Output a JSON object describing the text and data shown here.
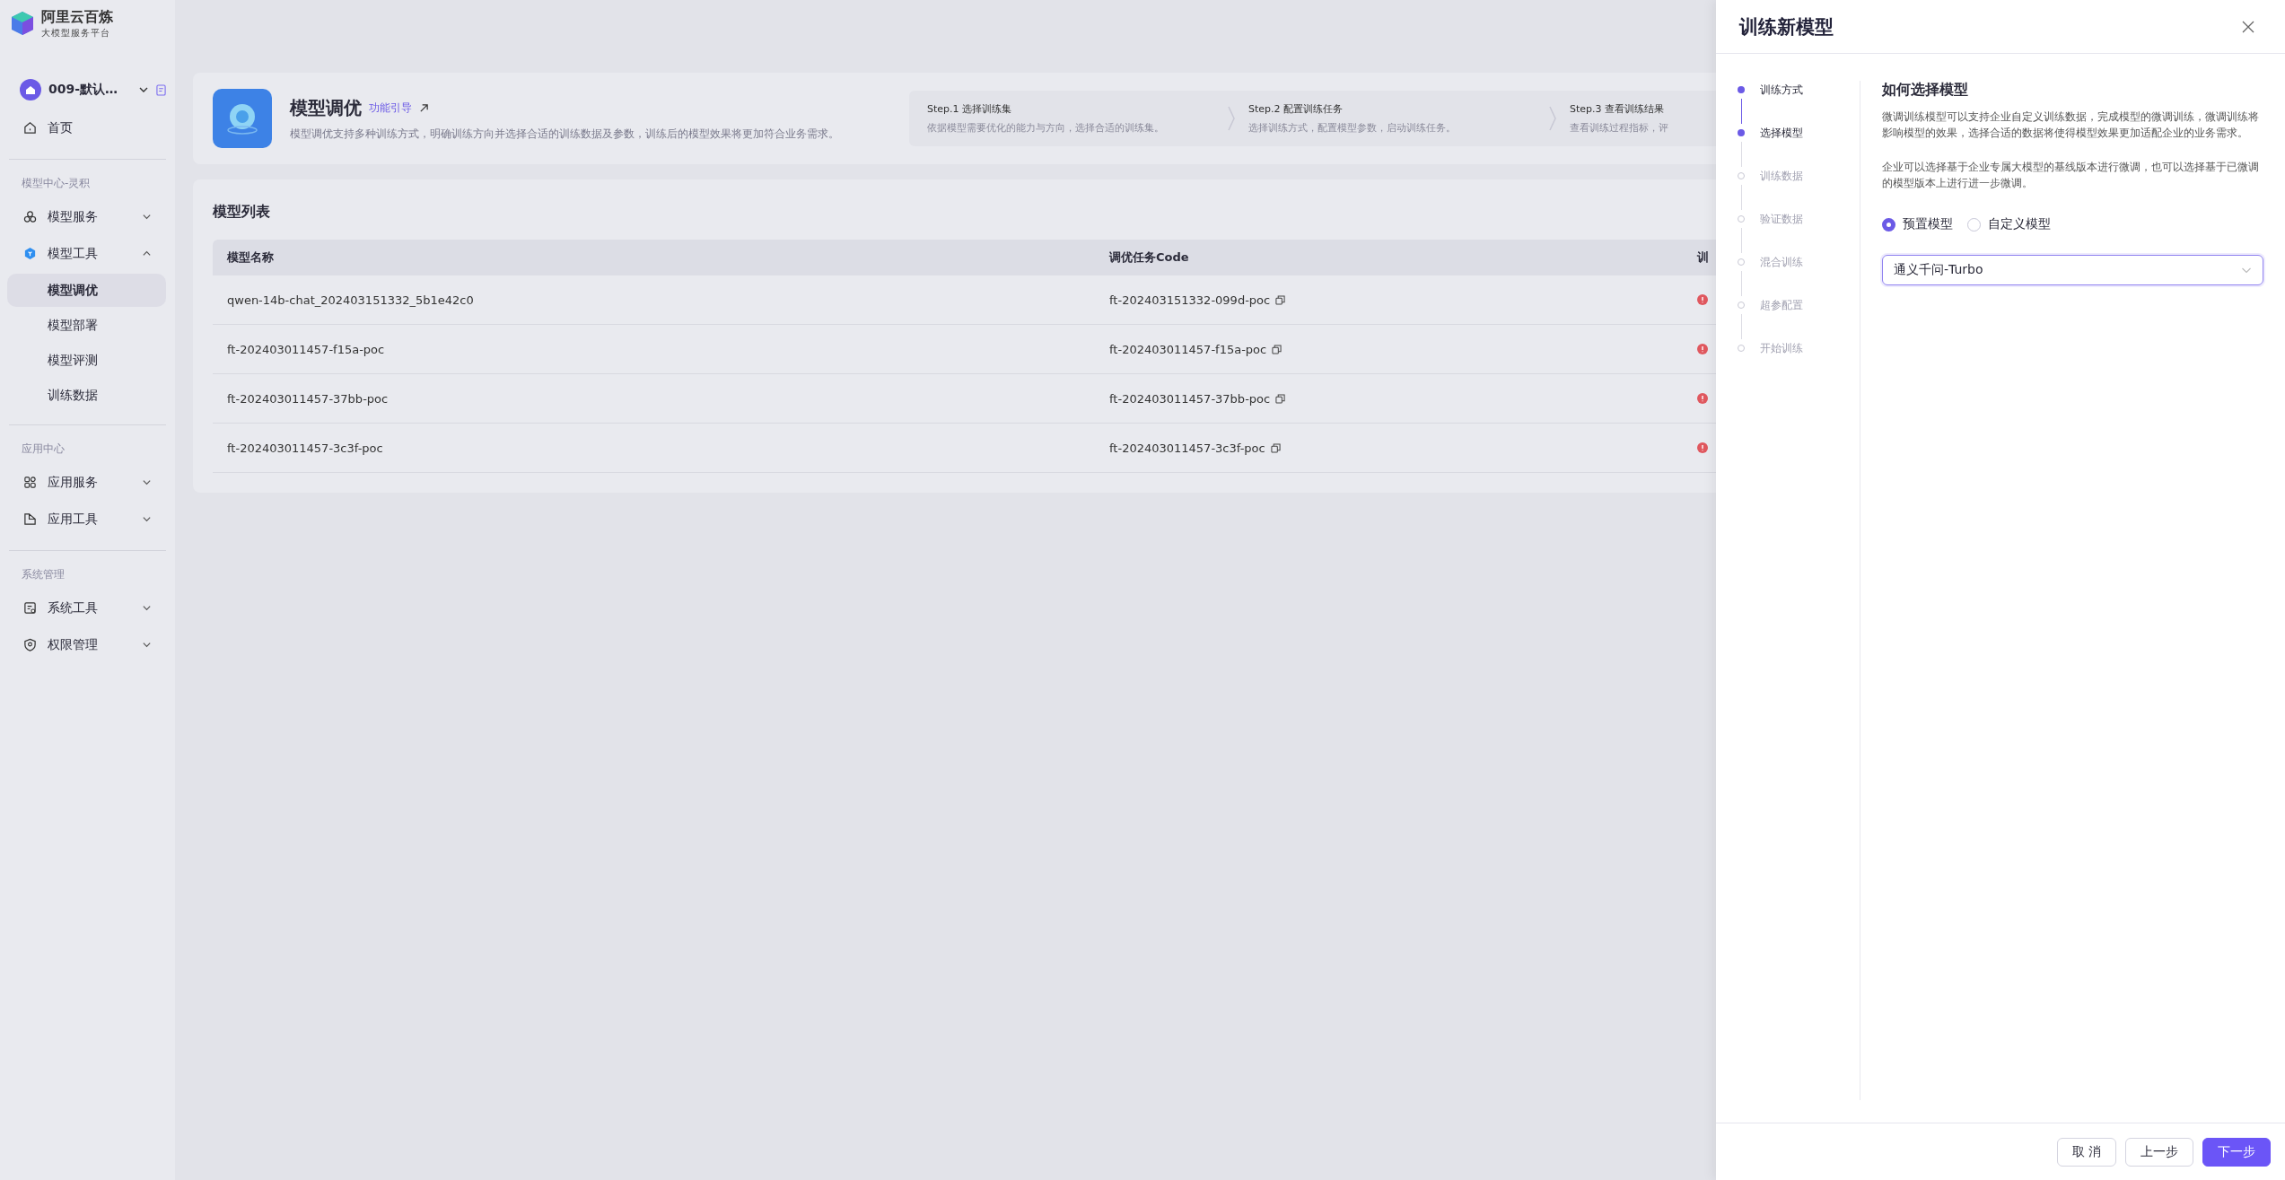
{
  "brand": {
    "title": "阿里云百炼",
    "subtitle": "大模型服务平台"
  },
  "sidebar": {
    "workspace": "009-默认…",
    "home": "首页",
    "sections": [
      {
        "title": "模型中心-灵积",
        "items": [
          {
            "label": "模型服务",
            "expanded": false
          },
          {
            "label": "模型工具",
            "expanded": true,
            "children": [
              {
                "label": "模型调优",
                "selected": true
              },
              {
                "label": "模型部署",
                "selected": false
              },
              {
                "label": "模型评测",
                "selected": false
              },
              {
                "label": "训练数据",
                "selected": false
              }
            ]
          }
        ]
      },
      {
        "title": "应用中心",
        "items": [
          {
            "label": "应用服务",
            "expanded": false
          },
          {
            "label": "应用工具",
            "expanded": false
          }
        ]
      },
      {
        "title": "系统管理",
        "items": [
          {
            "label": "系统工具",
            "expanded": false
          },
          {
            "label": "权限管理",
            "expanded": false
          }
        ]
      }
    ]
  },
  "intro": {
    "title": "模型调优",
    "guide_link": "功能引导",
    "description": "模型调优支持多种训练方式，明确训练方向并选择合适的训练数据及参数，训练后的模型效果将更加符合业务需求。",
    "steps": [
      {
        "title": "Step.1 选择训练集",
        "description": "依据模型需要优化的能力与方向，选择合适的训练集。"
      },
      {
        "title": "Step.2 配置训练任务",
        "description": "选择训练方式，配置模型参数，启动训练任务。"
      },
      {
        "title": "Step.3 查看训练结果",
        "description": "查看训练过程指标，评"
      }
    ]
  },
  "table": {
    "title": "模型列表",
    "columns": [
      "模型名称",
      "调优任务Code",
      "训"
    ],
    "rows": [
      {
        "name": "qwen-14b-chat_202403151332_5b1e42c0",
        "code": "ft-202403151332-099d-poc"
      },
      {
        "name": "ft-202403011457-f15a-poc",
        "code": "ft-202403011457-f15a-poc"
      },
      {
        "name": "ft-202403011457-37bb-poc",
        "code": "ft-202403011457-37bb-poc"
      },
      {
        "name": "ft-202403011457-3c3f-poc",
        "code": "ft-202403011457-3c3f-poc"
      }
    ]
  },
  "drawer": {
    "title": "训练新模型",
    "steps": [
      {
        "label": "训练方式",
        "done": true
      },
      {
        "label": "选择模型",
        "done": true
      },
      {
        "label": "训练数据",
        "done": false
      },
      {
        "label": "验证数据",
        "done": false
      },
      {
        "label": "混合训练",
        "done": false
      },
      {
        "label": "超参配置",
        "done": false
      },
      {
        "label": "开始训练",
        "done": false
      }
    ],
    "heading": "如何选择模型",
    "paragraphs": [
      "微调训练模型可以支持企业自定义训练数据，完成模型的微调训练，微调训练将影响模型的效果，选择合适的数据将使得模型效果更加适配企业的业务需求。",
      "企业可以选择基于企业专属大模型的基线版本进行微调，也可以选择基于已微调的模型版本上进行进一步微调。"
    ],
    "model_source": [
      {
        "label": "预置模型",
        "selected": true
      },
      {
        "label": "自定义模型",
        "selected": false
      }
    ],
    "model_select": {
      "value": "通义千问-Turbo"
    },
    "buttons": [
      {
        "label": "取 消",
        "kind": "default"
      },
      {
        "label": "上一步",
        "kind": "default"
      },
      {
        "label": "下一步",
        "kind": "primary"
      }
    ]
  }
}
